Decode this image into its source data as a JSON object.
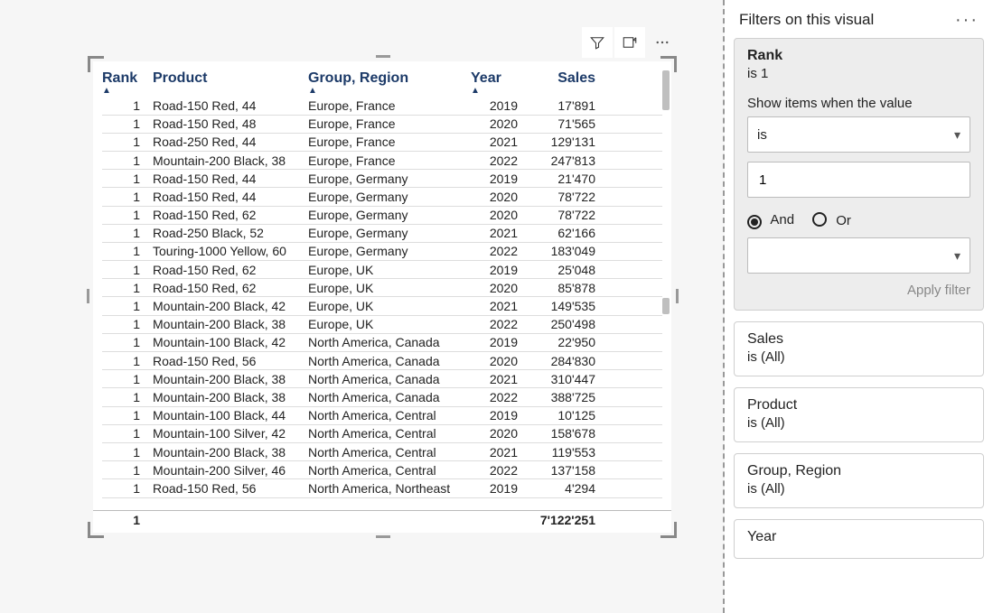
{
  "toolbar": {
    "filter_icon": "filter-icon",
    "focus_icon": "focus-mode-icon",
    "more_icon": "more-options-icon"
  },
  "table": {
    "columns": {
      "rank": "Rank",
      "product": "Product",
      "group": "Group, Region",
      "year": "Year",
      "sales": "Sales"
    },
    "sorted_columns": [
      "rank",
      "group",
      "year"
    ],
    "rows": [
      {
        "rank": "1",
        "product": "Road-150 Red, 44",
        "group": "Europe, France",
        "year": "2019",
        "sales": "17'891"
      },
      {
        "rank": "1",
        "product": "Road-150 Red, 48",
        "group": "Europe, France",
        "year": "2020",
        "sales": "71'565"
      },
      {
        "rank": "1",
        "product": "Road-250 Red, 44",
        "group": "Europe, France",
        "year": "2021",
        "sales": "129'131"
      },
      {
        "rank": "1",
        "product": "Mountain-200 Black, 38",
        "group": "Europe, France",
        "year": "2022",
        "sales": "247'813"
      },
      {
        "rank": "1",
        "product": "Road-150 Red, 44",
        "group": "Europe, Germany",
        "year": "2019",
        "sales": "21'470"
      },
      {
        "rank": "1",
        "product": "Road-150 Red, 44",
        "group": "Europe, Germany",
        "year": "2020",
        "sales": "78'722"
      },
      {
        "rank": "1",
        "product": "Road-150 Red, 62",
        "group": "Europe, Germany",
        "year": "2020",
        "sales": "78'722"
      },
      {
        "rank": "1",
        "product": "Road-250 Black, 52",
        "group": "Europe, Germany",
        "year": "2021",
        "sales": "62'166"
      },
      {
        "rank": "1",
        "product": "Touring-1000 Yellow, 60",
        "group": "Europe, Germany",
        "year": "2022",
        "sales": "183'049"
      },
      {
        "rank": "1",
        "product": "Road-150 Red, 62",
        "group": "Europe, UK",
        "year": "2019",
        "sales": "25'048"
      },
      {
        "rank": "1",
        "product": "Road-150 Red, 62",
        "group": "Europe, UK",
        "year": "2020",
        "sales": "85'878"
      },
      {
        "rank": "1",
        "product": "Mountain-200 Black, 42",
        "group": "Europe, UK",
        "year": "2021",
        "sales": "149'535"
      },
      {
        "rank": "1",
        "product": "Mountain-200 Black, 38",
        "group": "Europe, UK",
        "year": "2022",
        "sales": "250'498"
      },
      {
        "rank": "1",
        "product": "Mountain-100 Black, 42",
        "group": "North America, Canada",
        "year": "2019",
        "sales": "22'950"
      },
      {
        "rank": "1",
        "product": "Road-150 Red, 56",
        "group": "North America, Canada",
        "year": "2020",
        "sales": "284'830"
      },
      {
        "rank": "1",
        "product": "Mountain-200 Black, 38",
        "group": "North America, Canada",
        "year": "2021",
        "sales": "310'447"
      },
      {
        "rank": "1",
        "product": "Mountain-200 Black, 38",
        "group": "North America, Canada",
        "year": "2022",
        "sales": "388'725"
      },
      {
        "rank": "1",
        "product": "Mountain-100 Black, 44",
        "group": "North America, Central",
        "year": "2019",
        "sales": "10'125"
      },
      {
        "rank": "1",
        "product": "Mountain-100 Silver, 42",
        "group": "North America, Central",
        "year": "2020",
        "sales": "158'678"
      },
      {
        "rank": "1",
        "product": "Mountain-200 Black, 38",
        "group": "North America, Central",
        "year": "2021",
        "sales": "119'553"
      },
      {
        "rank": "1",
        "product": "Mountain-200 Silver, 46",
        "group": "North America, Central",
        "year": "2022",
        "sales": "137'158"
      },
      {
        "rank": "1",
        "product": "Road-150 Red, 56",
        "group": "North America, Northeast",
        "year": "2019",
        "sales": "4'294"
      }
    ],
    "footer": {
      "rank": "1",
      "sales": "7'122'251"
    }
  },
  "filters": {
    "pane_title": "Filters on this visual",
    "rank": {
      "title": "Rank",
      "summary": "is 1",
      "show_label": "Show items when the value",
      "operator": "is",
      "value": "1",
      "logic_and": "And",
      "logic_or": "Or",
      "logic_selected": "and",
      "operator2": "",
      "apply_label": "Apply filter"
    },
    "sales": {
      "title": "Sales",
      "summary": "is (All)"
    },
    "product": {
      "title": "Product",
      "summary": "is (All)"
    },
    "group": {
      "title": "Group, Region",
      "summary": "is (All)"
    },
    "year": {
      "title": "Year",
      "summary": ""
    }
  }
}
